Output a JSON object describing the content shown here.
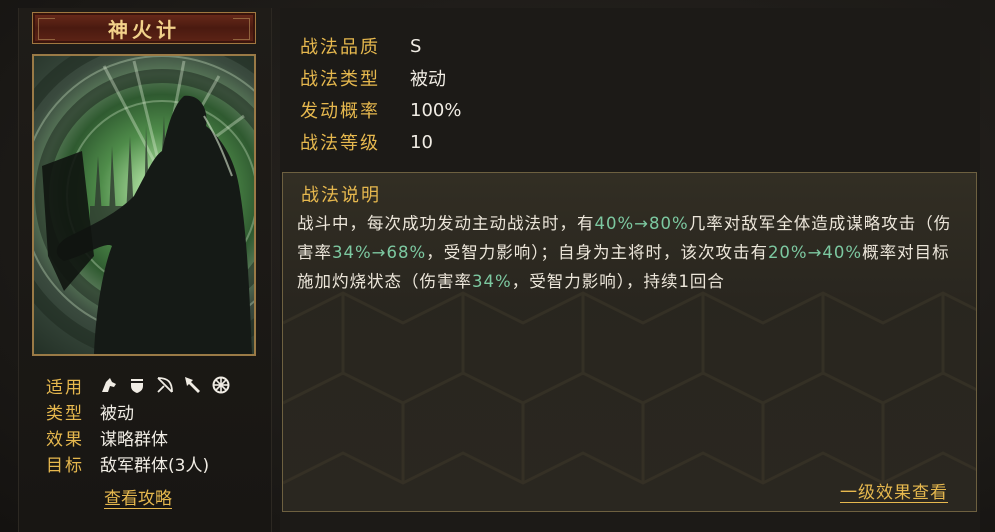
{
  "tactic": {
    "name": "神火计"
  },
  "attributes": [
    {
      "key": "适用",
      "value": ""
    },
    {
      "key": "类型",
      "value": "被动"
    },
    {
      "key": "效果",
      "value": "谋略群体"
    },
    {
      "key": "目标",
      "value": "敌军群体(3人)"
    }
  ],
  "troop_icons": [
    "cavalry-icon",
    "shield-icon",
    "bow-icon",
    "spear-icon",
    "wheel-icon"
  ],
  "guide_link": "查看攻略",
  "stats": [
    {
      "key": "战法品质",
      "value": "S"
    },
    {
      "key": "战法类型",
      "value": "被动"
    },
    {
      "key": "发动概率",
      "value": "100%"
    },
    {
      "key": "战法等级",
      "value": "10"
    }
  ],
  "description": {
    "title": "战法说明",
    "segments": [
      {
        "text": "战斗中，每次成功发动主动战法时，有",
        "highlight": false
      },
      {
        "text": "40%→80%",
        "highlight": true
      },
      {
        "text": "几率对敌军全体造成谋略攻击（伤害率",
        "highlight": false
      },
      {
        "text": "34%→68%",
        "highlight": true
      },
      {
        "text": "，受智力影响）；自身为主将时，该次攻击有",
        "highlight": false
      },
      {
        "text": "20%→40%",
        "highlight": true
      },
      {
        "text": "概率对目标施加灼烧状态（伤害率",
        "highlight": false
      },
      {
        "text": "34%",
        "highlight": true
      },
      {
        "text": "，受智力影响），持续1回合",
        "highlight": false
      }
    ]
  },
  "effect_link": "一级效果查看",
  "colors": {
    "gold": "#e6b84e",
    "highlight": "#7cc8a0",
    "banner": "#5e2416"
  }
}
